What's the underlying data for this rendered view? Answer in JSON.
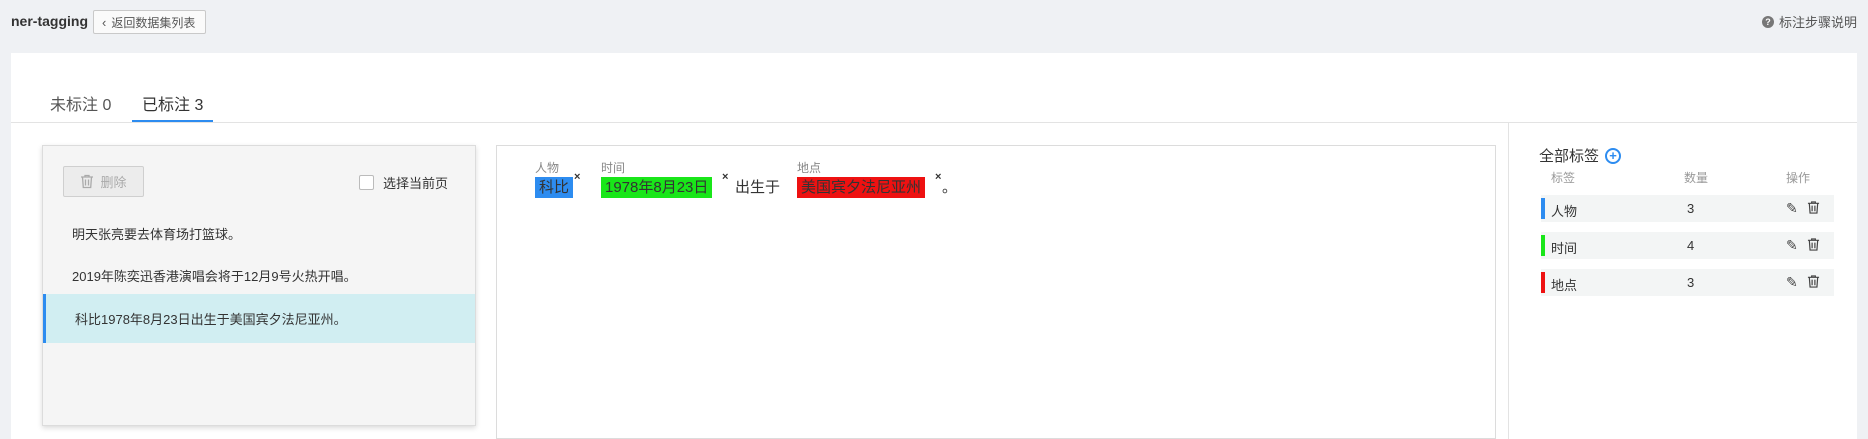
{
  "header": {
    "app_title": "ner-tagging",
    "back_label": "返回数据集列表",
    "help_label": "标注步骤说明"
  },
  "tabs": [
    {
      "label": "未标注 0",
      "active": false
    },
    {
      "label": "已标注 3",
      "active": true
    }
  ],
  "left_panel": {
    "delete_label": "删除",
    "select_page_label": "选择当前页",
    "sentences": [
      {
        "text": "明天张亮要去体育场打篮球。",
        "active": false
      },
      {
        "text": "2019年陈奕迅香港演唱会将于12月9号火热开唱。",
        "active": false
      },
      {
        "text": "科比1978年8月23日出生于美国宾夕法尼亚州。",
        "active": true
      }
    ]
  },
  "editor": {
    "annotations": [
      {
        "label": "人物",
        "text": "科比",
        "color": "#2d8cf0"
      },
      {
        "label": "时间",
        "text": "1978年8月23日",
        "color": "#19e619"
      },
      {
        "label": "地点",
        "text": "美国宾夕法尼亚州",
        "color": "#ee1111"
      }
    ],
    "plain_1": "出生于",
    "plain_2": "。",
    "remove_glyph": "×"
  },
  "right_panel": {
    "title": "全部标签",
    "columns": [
      "标签",
      "数量",
      "操作"
    ],
    "labels": [
      {
        "name": "人物",
        "count": "3",
        "color": "#2d8cf0"
      },
      {
        "name": "时间",
        "count": "4",
        "color": "#19e619"
      },
      {
        "name": "地点",
        "count": "3",
        "color": "#ee1111"
      }
    ]
  },
  "icons": {
    "back": "chevron-left-icon",
    "help": "question-circle-icon",
    "add": "plus-circle-icon",
    "edit": "pencil-icon",
    "delete": "trash-icon"
  }
}
